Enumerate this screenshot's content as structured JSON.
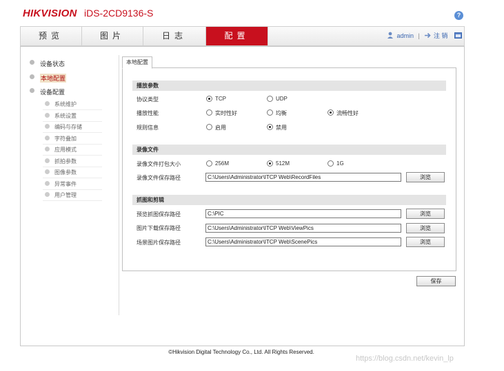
{
  "header": {
    "brand": "HIKVISION",
    "model": "iDS-2CD9136-S",
    "help": "?"
  },
  "nav": {
    "tabs": [
      {
        "label": "预览"
      },
      {
        "label": "图片"
      },
      {
        "label": "日志"
      },
      {
        "label": "配置",
        "active": true
      }
    ],
    "user": "admin",
    "separator": "|",
    "logout": "注 销"
  },
  "sidebar": {
    "items": [
      {
        "label": "设备状态"
      },
      {
        "label": "本地配置",
        "active": true
      },
      {
        "label": "设备配置"
      }
    ],
    "subitems": [
      "系统维护",
      "系统设置",
      "编码与存储",
      "字符叠加",
      "应用模式",
      "抓拍参数",
      "图像参数",
      "异常事件",
      "用户管理"
    ]
  },
  "content": {
    "tab": "本地配置",
    "sections": {
      "play": {
        "title": "播放参数",
        "protocol": {
          "label": "协议类型",
          "options": [
            "TCP",
            "UDP"
          ],
          "selected": "TCP"
        },
        "performance": {
          "label": "播放性能",
          "options": [
            "实时性好",
            "均衡",
            "流畅性好"
          ],
          "selected": "流畅性好"
        },
        "rules": {
          "label": "规则信息",
          "options": [
            "启用",
            "禁用"
          ],
          "selected": "禁用"
        }
      },
      "record": {
        "title": "录像文件",
        "size": {
          "label": "录像文件打包大小",
          "options": [
            "256M",
            "512M",
            "1G"
          ],
          "selected": "512M"
        },
        "path": {
          "label": "录像文件保存路径",
          "value": "C:\\Users\\Administrator\\ITCP Web\\RecordFiles"
        }
      },
      "capture": {
        "title": "抓图和剪辑",
        "preview": {
          "label": "预览抓图保存路径",
          "value": "C:\\PIC"
        },
        "download": {
          "label": "图片下载保存路径",
          "value": "C:\\Users\\Administrator\\ITCP Web\\ViewPics"
        },
        "scene": {
          "label": "场景图片保存路径",
          "value": "C:\\Users\\Administrator\\ITCP Web\\ScenePics"
        }
      }
    },
    "browse_label": "浏览",
    "save_label": "保存"
  },
  "footer": "©Hikvision Digital Technology Co., Ltd. All Rights Reserved.",
  "watermark": "https://blog.csdn.net/kevin_lp",
  "colors": {
    "accent": "#c8101e",
    "link": "#3a66b0"
  }
}
